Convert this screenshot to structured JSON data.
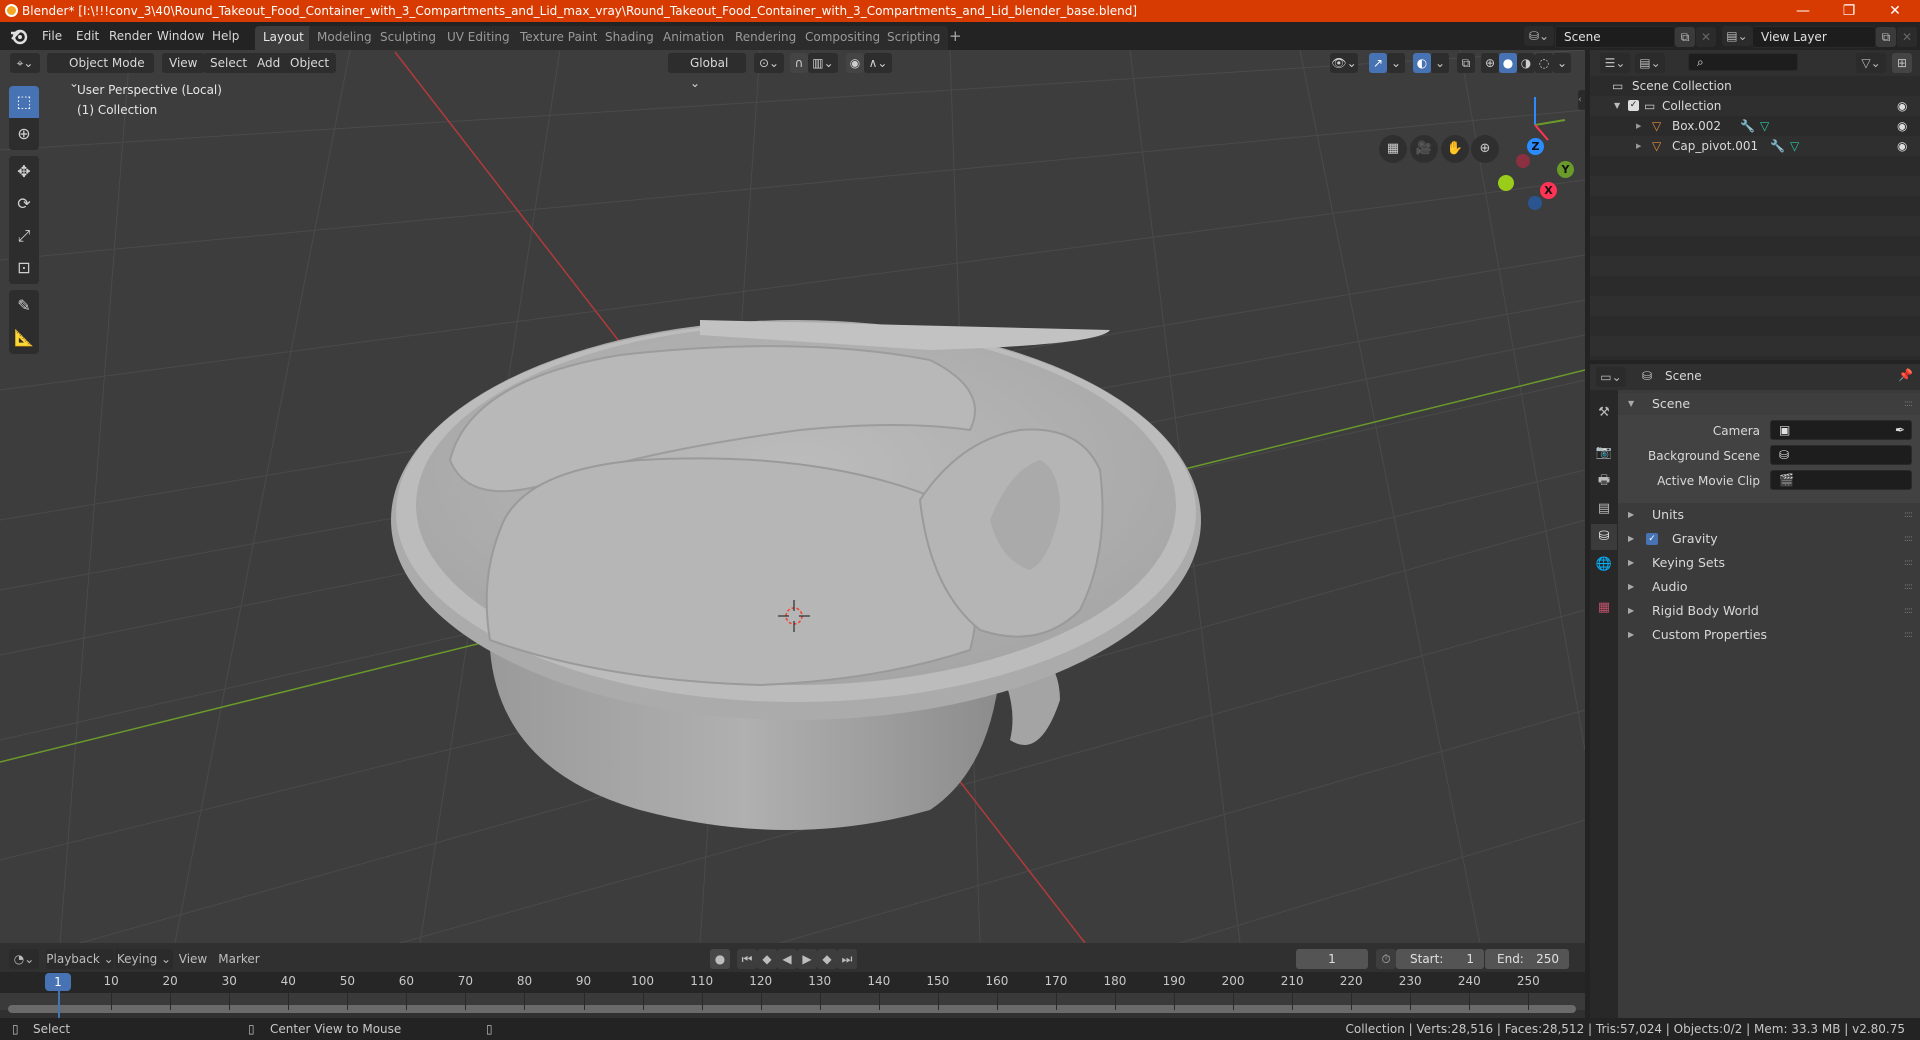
{
  "window": {
    "title": "Blender* [I:\\!!!conv_3\\40\\Round_Takeout_Food_Container_with_3_Compartments_and_Lid_max_vray\\Round_Takeout_Food_Container_with_3_Compartments_and_Lid_blender_base.blend]",
    "minimize": "—",
    "maximize": "❐",
    "close": "✕"
  },
  "menubar": {
    "items": [
      "File",
      "Edit",
      "Render",
      "Window",
      "Help"
    ],
    "workspaces": [
      "Layout",
      "Modeling",
      "Sculpting",
      "UV Editing",
      "Texture Paint",
      "Shading",
      "Animation",
      "Rendering",
      "Compositing",
      "Scripting"
    ],
    "active_workspace": "Layout",
    "add_workspace": "+",
    "scene": "Scene",
    "view_layer": "View Layer"
  },
  "viewport": {
    "mode": "Object Mode",
    "menus": [
      "View",
      "Select",
      "Add",
      "Object"
    ],
    "transform_orientation": "Global",
    "overlay_text": {
      "line1": "User Perspective (Local)",
      "line2": "(1) Collection"
    },
    "gizmo": {
      "x": "X",
      "y": "Y",
      "z": "Z"
    },
    "colors": {
      "x_axis": "#c73a3a",
      "y_axis": "#6a9a2a",
      "accent": "#4772b3",
      "mesh": "#b4b4b4"
    }
  },
  "outliner": {
    "root": "Scene Collection",
    "collection": "Collection",
    "objects": [
      {
        "name": "Box.002"
      },
      {
        "name": "Cap_pivot.001"
      }
    ]
  },
  "properties": {
    "header": "Scene",
    "panel_title": "Scene",
    "fields": [
      {
        "label": "Camera",
        "value": ""
      },
      {
        "label": "Background Scene",
        "value": ""
      },
      {
        "label": "Active Movie Clip",
        "value": ""
      }
    ],
    "sections": [
      {
        "label": "Units"
      },
      {
        "label": "Gravity",
        "checked": true
      },
      {
        "label": "Keying Sets"
      },
      {
        "label": "Audio"
      },
      {
        "label": "Rigid Body World"
      },
      {
        "label": "Custom Properties"
      }
    ]
  },
  "timeline": {
    "menus": [
      "Playback",
      "Keying",
      "View",
      "Marker"
    ],
    "current_frame": "1",
    "start_label": "Start:",
    "start": "1",
    "end_label": "End:",
    "end": "250",
    "ticks": [
      "10",
      "20",
      "30",
      "40",
      "50",
      "60",
      "70",
      "80",
      "90",
      "100",
      "110",
      "120",
      "130",
      "140",
      "150",
      "160",
      "170",
      "180",
      "190",
      "200",
      "210",
      "220",
      "230",
      "240",
      "250"
    ],
    "playhead_label": "1"
  },
  "statusbar": {
    "left_action": "Select",
    "middle_action": "Center View to Mouse",
    "stats": "Collection | Verts:28,516 | Faces:28,512 | Tris:57,024 | Objects:0/2 | Mem: 33.3 MB | v2.80.75"
  }
}
